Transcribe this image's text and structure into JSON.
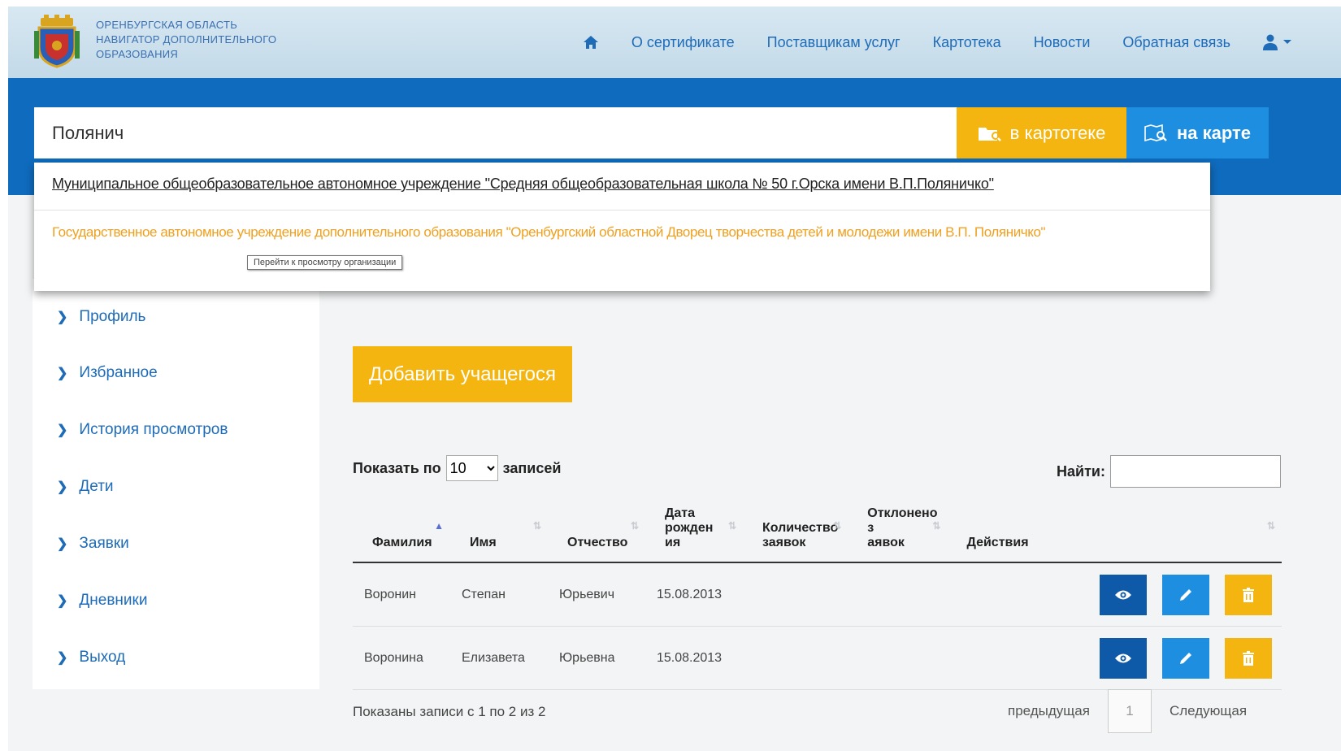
{
  "header": {
    "brand_line1": "Оренбургская область",
    "brand_line2": "Навигатор дополнительного",
    "brand_line3": "образования",
    "nav": [
      {
        "label": "О сертификате"
      },
      {
        "label": "Поставщикам услуг"
      },
      {
        "label": "Картотека"
      },
      {
        "label": "Новости"
      },
      {
        "label": "Обратная связь"
      }
    ]
  },
  "search": {
    "value": "Полянич",
    "btn_catalog": "в картотеке",
    "btn_map": "на карте"
  },
  "suggestions": {
    "item1": "Муниципальное общеобразовательное автономное учреждение \"Средняя общеобразовательная школа № 50 г.Орска имени В.П.Поляничко\"",
    "item2": "Государственное автономное учреждение дополнительного образования \"Оренбургский областной Дворец творчества детей и молодежи имени В.П. Поляничко\"",
    "tooltip": "Перейти к просмотру организации"
  },
  "sidebar": {
    "items": [
      {
        "label": "Профиль"
      },
      {
        "label": "Избранное"
      },
      {
        "label": "История просмотров"
      },
      {
        "label": "Дети"
      },
      {
        "label": "Заявки"
      },
      {
        "label": "Дневники"
      },
      {
        "label": "Выход"
      }
    ]
  },
  "main": {
    "add_button": "Добавить учащегося",
    "show_prefix": "Показать по",
    "show_value": "10",
    "show_suffix": "записей",
    "find_label": "Найти:",
    "columns": [
      {
        "label_a": "Фамилия",
        "label_b": ""
      },
      {
        "label_a": "Имя",
        "label_b": ""
      },
      {
        "label_a": "Отчество",
        "label_b": ""
      },
      {
        "label_a": "Дата рожден",
        "label_b": "ия"
      },
      {
        "label_a": "Количество",
        "label_b": "заявок"
      },
      {
        "label_a": "Отклонено з",
        "label_b": "аявок"
      },
      {
        "label_a": "Действия",
        "label_b": ""
      }
    ],
    "rows": [
      {
        "surname": "Воронин",
        "name": "Степан",
        "patronymic": "Юрьевич",
        "birth": "15.08.2013",
        "apps": "",
        "rejected": ""
      },
      {
        "surname": "Воронина",
        "name": "Елизавета",
        "patronymic": "Юрьевна",
        "birth": "15.08.2013",
        "apps": "",
        "rejected": ""
      }
    ],
    "footer_info": "Показаны записи с 1 по 2 из 2",
    "prev": "предыдущая",
    "page": "1",
    "next": "Следующая"
  },
  "colors": {
    "primary_blue": "#0f6bbd",
    "accent_yellow": "#f5b510",
    "light_blue": "#1e8fe0"
  }
}
